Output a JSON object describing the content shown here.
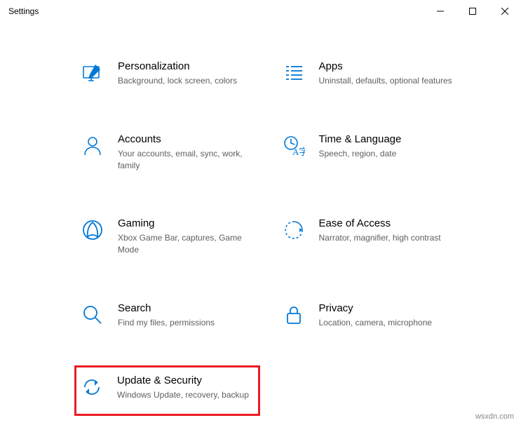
{
  "window": {
    "title": "Settings"
  },
  "colors": {
    "accent": "#0078d7",
    "highlight": "#ed1c24"
  },
  "categories": [
    {
      "id": "personalization",
      "title": "Personalization",
      "desc": "Background, lock screen, colors"
    },
    {
      "id": "apps",
      "title": "Apps",
      "desc": "Uninstall, defaults, optional features"
    },
    {
      "id": "accounts",
      "title": "Accounts",
      "desc": "Your accounts, email, sync, work, family"
    },
    {
      "id": "time_language",
      "title": "Time & Language",
      "desc": "Speech, region, date"
    },
    {
      "id": "gaming",
      "title": "Gaming",
      "desc": "Xbox Game Bar, captures, Game Mode"
    },
    {
      "id": "ease_of_access",
      "title": "Ease of Access",
      "desc": "Narrator, magnifier, high contrast"
    },
    {
      "id": "search",
      "title": "Search",
      "desc": "Find my files, permissions"
    },
    {
      "id": "privacy",
      "title": "Privacy",
      "desc": "Location, camera, microphone"
    },
    {
      "id": "update_security",
      "title": "Update & Security",
      "desc": "Windows Update, recovery, backup",
      "highlighted": true
    }
  ],
  "watermark": "wsxdn.com"
}
